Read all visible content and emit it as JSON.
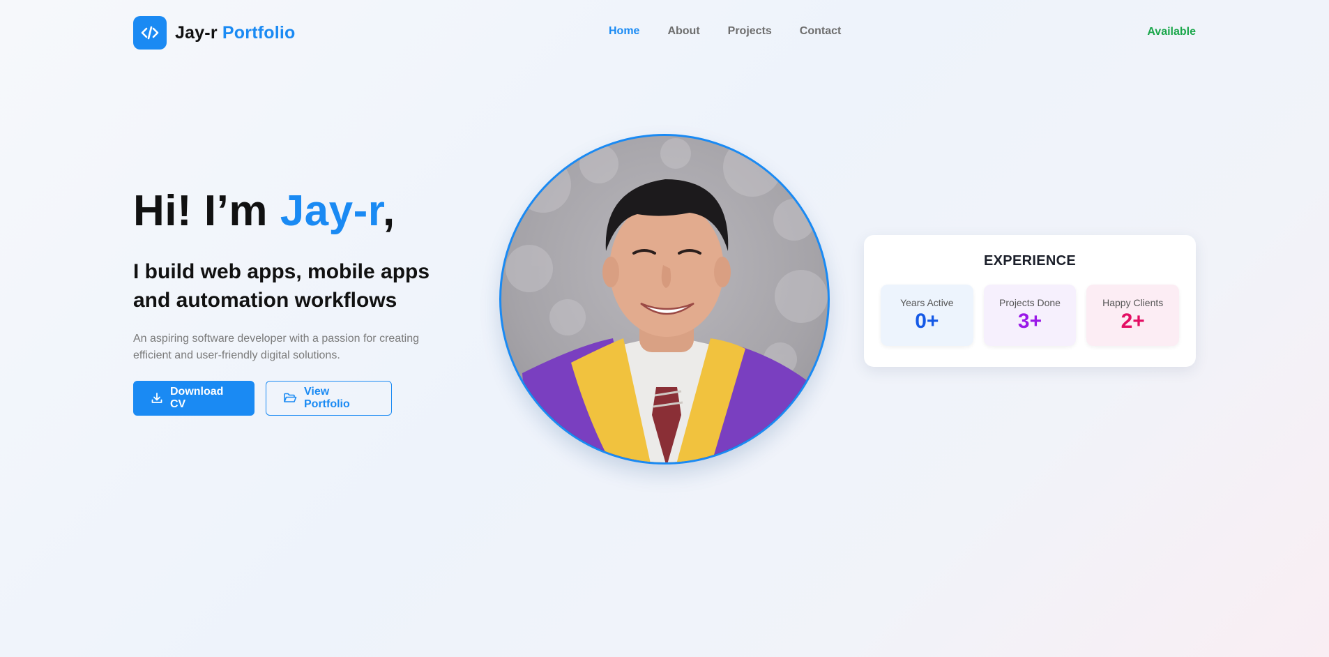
{
  "header": {
    "logo_name": "Jay-r",
    "logo_accent": "Portfolio",
    "logo_icon": "code-icon",
    "nav": [
      {
        "label": "Home",
        "active": true
      },
      {
        "label": "About",
        "active": false
      },
      {
        "label": "Projects",
        "active": false
      },
      {
        "label": "Contact",
        "active": false
      }
    ],
    "status": "Available"
  },
  "hero": {
    "greeting": "Hi! I’m",
    "name": "Jay-r",
    "comma": ",",
    "subtitle": "I build web apps, mobile apps and automation workflows",
    "description": "An aspiring software developer with a passion for creating efficient and user-friendly digital solutions.",
    "buttons": {
      "download_label": "Download CV",
      "download_icon": "download-icon",
      "portfolio_label": "View Portfolio",
      "portfolio_icon": "folder-open-icon"
    }
  },
  "experience": {
    "title": "EXPERIENCE",
    "stats": [
      {
        "label": "Years Active",
        "value": "0+",
        "color": "#1559e6"
      },
      {
        "label": "Projects Done",
        "value": "3+",
        "color": "#9a19e8"
      },
      {
        "label": "Happy Clients",
        "value": "2+",
        "color": "#e30e63"
      }
    ]
  },
  "colors": {
    "accent": "#1a8af3",
    "status": "#1aa64a",
    "gown_purple": "#7a3fc0",
    "stole_yellow": "#f1c23e"
  }
}
